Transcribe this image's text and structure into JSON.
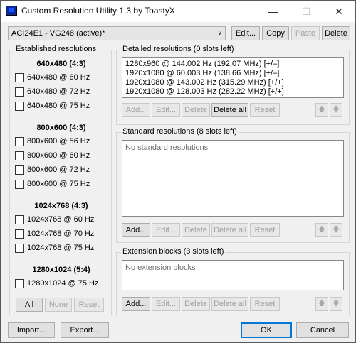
{
  "window": {
    "title": "Custom Resolution Utility 1.3 by ToastyX"
  },
  "icons": {
    "app": "monitor-icon",
    "minimize": "minimize-icon",
    "maximize": "maximize-icon",
    "close": "close-icon"
  },
  "titlebar": {
    "minimize": "—",
    "maximize": "☐",
    "close": "✕"
  },
  "monitor_select": {
    "value": "ACI24E1 - VG248 (active)*",
    "arrow": "∨"
  },
  "top_buttons": {
    "edit": "Edit...",
    "copy": "Copy",
    "paste": "Paste",
    "delete": "Delete"
  },
  "established": {
    "title": "Established resolutions",
    "groups": [
      {
        "header": "640x480 (4:3)",
        "items": [
          "640x480 @ 60 Hz",
          "640x480 @ 72 Hz",
          "640x480 @ 75 Hz"
        ]
      },
      {
        "header": "800x600 (4:3)",
        "items": [
          "800x600 @ 56 Hz",
          "800x600 @ 60 Hz",
          "800x600 @ 72 Hz",
          "800x600 @ 75 Hz"
        ]
      },
      {
        "header": "1024x768 (4:3)",
        "items": [
          "1024x768 @ 60 Hz",
          "1024x768 @ 70 Hz",
          "1024x768 @ 75 Hz"
        ]
      },
      {
        "header": "1280x1024 (5:4)",
        "items": [
          "1280x1024 @ 75 Hz"
        ]
      }
    ],
    "buttons": {
      "all": "All",
      "none": "None",
      "reset": "Reset"
    }
  },
  "detailed": {
    "title": "Detailed resolutions (0 slots left)",
    "rows": [
      "1280x960 @ 144.002 Hz (192.07 MHz) [+/–]",
      "1920x1080 @ 60.003 Hz (138.66 MHz) [+/–]",
      "1920x1080 @ 143.002 Hz (315.29 MHz) [+/+]",
      "1920x1080 @ 128.003 Hz (282.22 MHz) [+/+]"
    ],
    "buttons": {
      "add": "Add...",
      "edit": "Edit...",
      "delete": "Delete",
      "delete_all": "Delete all",
      "reset": "Reset"
    }
  },
  "standard": {
    "title": "Standard resolutions (8 slots left)",
    "empty": "No standard resolutions",
    "buttons": {
      "add": "Add...",
      "edit": "Edit...",
      "delete": "Delete",
      "delete_all": "Delete all",
      "reset": "Reset"
    }
  },
  "extension": {
    "title": "Extension blocks (3 slots left)",
    "empty": "No extension blocks",
    "buttons": {
      "add": "Add...",
      "edit": "Edit...",
      "delete": "Delete",
      "delete_all": "Delete all",
      "reset": "Reset"
    }
  },
  "arrows": {
    "up": "🡅",
    "down": "🡇"
  },
  "footer": {
    "import": "Import...",
    "export": "Export...",
    "ok": "OK",
    "cancel": "Cancel"
  }
}
